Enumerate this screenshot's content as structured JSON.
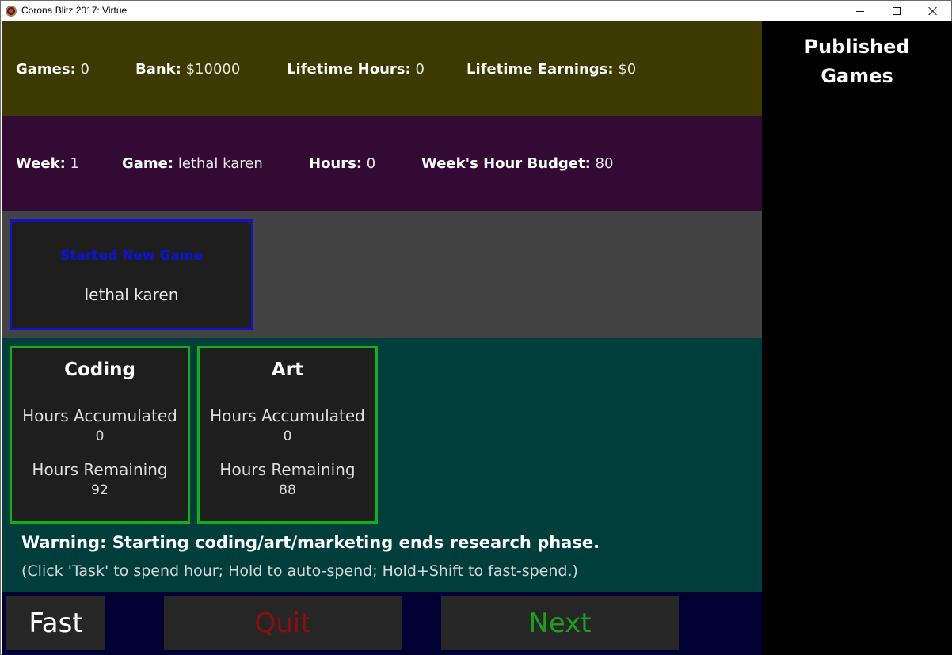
{
  "window": {
    "title": "Corona Blitz 2017: Virtue"
  },
  "stats": {
    "games_label": "Games:",
    "games_value": "0",
    "bank_label": "Bank:",
    "bank_value": "$10000",
    "lifetime_hours_label": "Lifetime Hours:",
    "lifetime_hours_value": "0",
    "lifetime_earnings_label": "Lifetime Earnings:",
    "lifetime_earnings_value": "$0"
  },
  "week": {
    "week_label": "Week:",
    "week_value": "1",
    "game_label": "Game:",
    "game_value": "lethal karen",
    "hours_label": "Hours:",
    "hours_value": "0",
    "budget_label": "Week's Hour Budget:",
    "budget_value": "80"
  },
  "event": {
    "title": "Started New Game",
    "subtitle": "lethal karen"
  },
  "tasks": [
    {
      "name": "Coding",
      "accumulated_label": "Hours Accumulated",
      "accumulated_value": "0",
      "remaining_label": "Hours Remaining",
      "remaining_value": "92"
    },
    {
      "name": "Art",
      "accumulated_label": "Hours Accumulated",
      "accumulated_value": "0",
      "remaining_label": "Hours Remaining",
      "remaining_value": "88"
    }
  ],
  "messages": {
    "warning": "Warning: Starting coding/art/marketing ends research phase.",
    "hint": "(Click 'Task' to spend hour; Hold to auto-spend; Hold+Shift to fast-spend.)"
  },
  "buttons": {
    "fast": "Fast",
    "quit": "Quit",
    "next": "Next"
  },
  "sidebar": {
    "title": "Published\nGames"
  },
  "colors": {
    "stats_bg": "#3c3a00",
    "week_bg": "#320a33",
    "event_bg": "#434343",
    "task_bg": "#003e3c",
    "bottom_bg": "#000033",
    "event_border": "#1313c8",
    "task_border": "#10b01d",
    "quit_text": "#8c0f0f",
    "next_text": "#1aa01a"
  }
}
